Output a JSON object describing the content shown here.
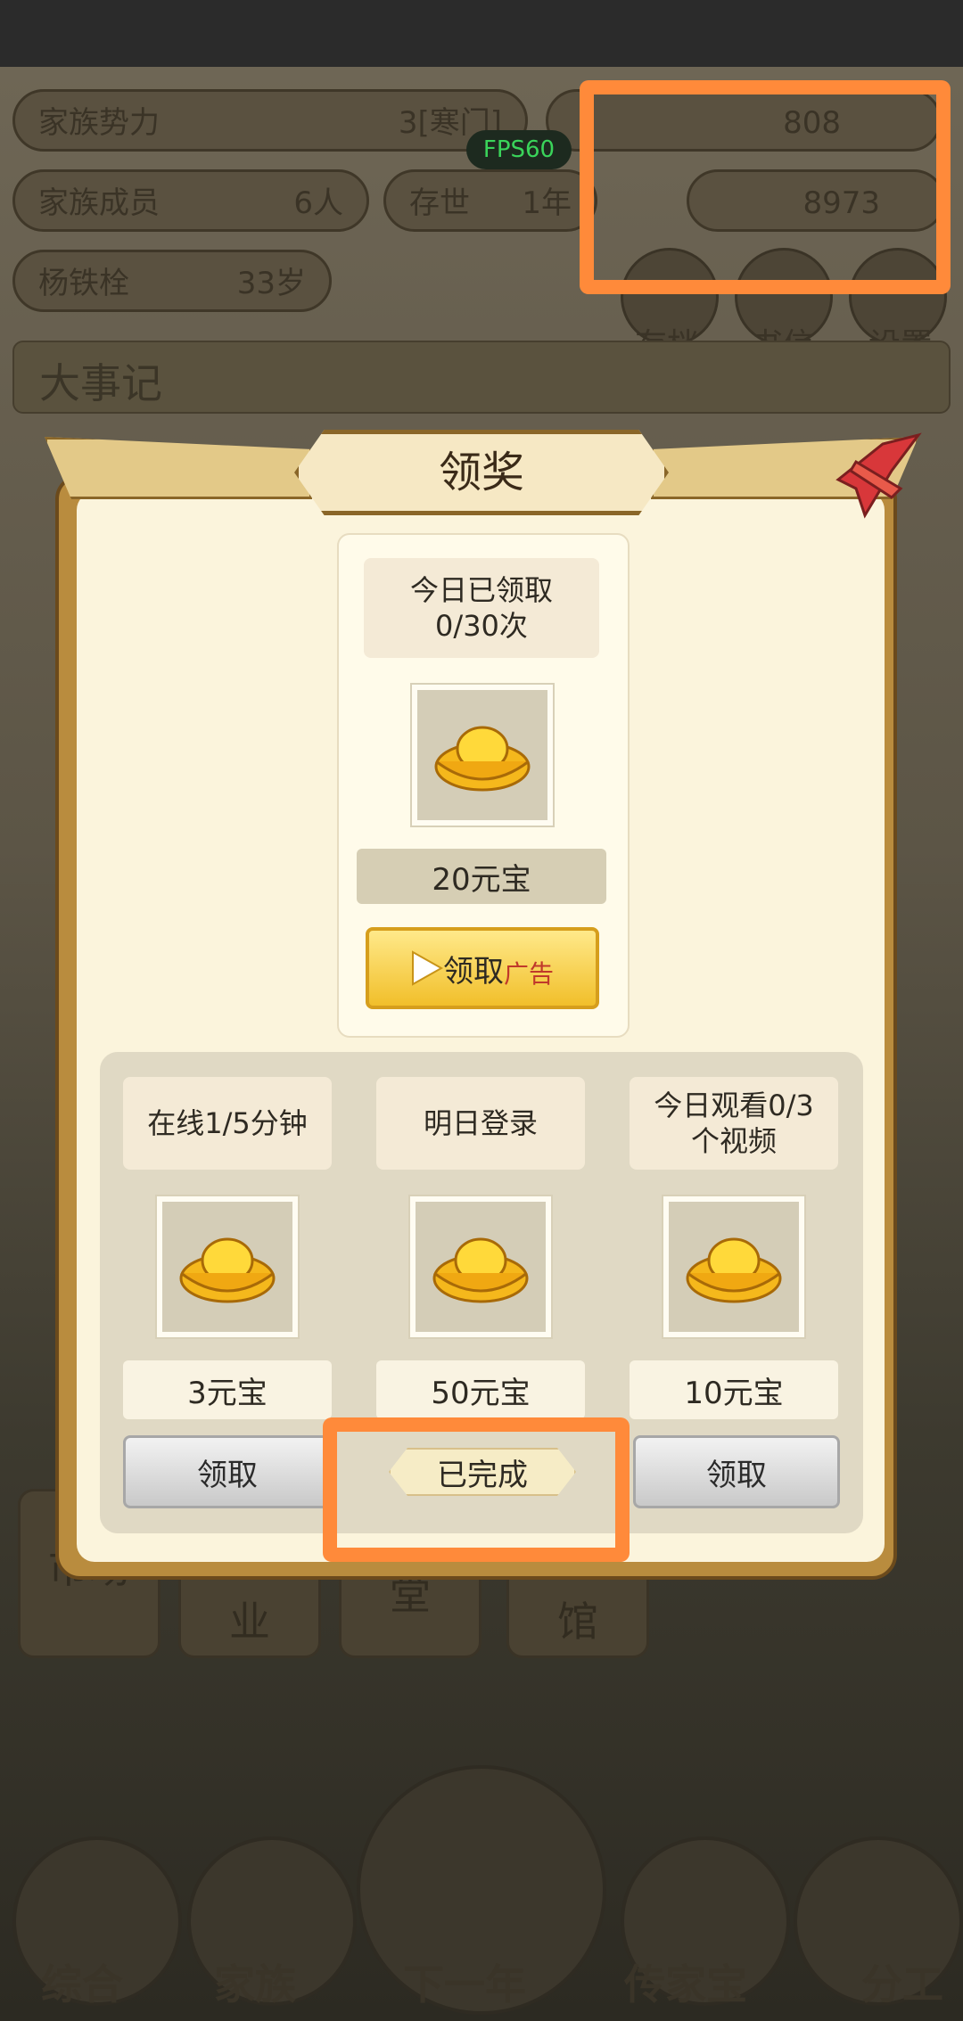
{
  "header": {
    "fps": "FPS60",
    "family_power_label": "家族势力",
    "family_power_value": "3[寒门]",
    "members_label": "家族成员",
    "members_value": "6人",
    "survival_label": "存世",
    "survival_value": "1年",
    "person_name": "杨铁栓",
    "person_age": "33岁",
    "currency1": "808",
    "currency2": "8973",
    "save_label": "存档",
    "letter_label": "书信",
    "settings_label": "设置",
    "annals_label": "大事记"
  },
  "bg_nav": [
    "市场",
    "业",
    "堂",
    "馆"
  ],
  "bottom_nav": [
    "综合",
    "家族",
    "下一年",
    "传家宝",
    "分工"
  ],
  "dialog": {
    "title": "领奖",
    "top_reward": {
      "claimed_line1": "今日已领取",
      "claimed_line2": "0/30次",
      "amount": "20元宝",
      "claim_label": "领取",
      "ad_label": "广告"
    },
    "rewards": [
      {
        "label": "在线1/5分钟",
        "amount": "3元宝",
        "button": "领取"
      },
      {
        "label": "明日登录",
        "amount": "50元宝",
        "button": "已完成"
      },
      {
        "label_line1": "今日观看0/3",
        "label_line2": "个视频",
        "amount": "10元宝",
        "button": "领取"
      }
    ]
  },
  "colors": {
    "highlight": "#ff8a3a",
    "gold": "#f5c518"
  }
}
